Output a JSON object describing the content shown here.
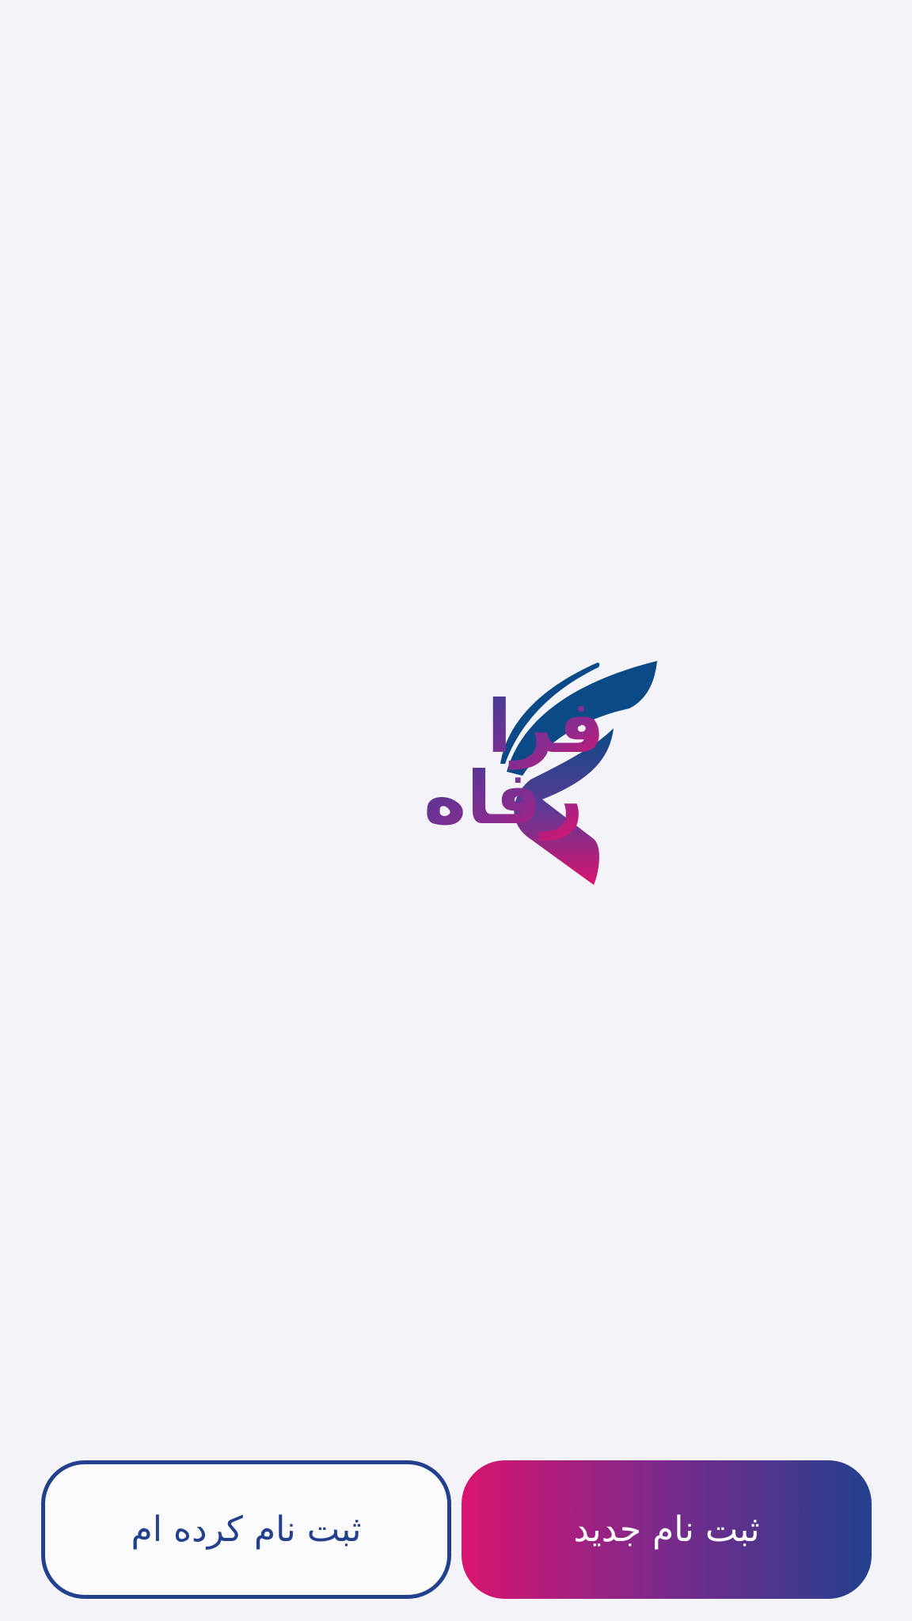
{
  "logo": {
    "brand_text_line1": "فرا",
    "brand_text_line2": "رفاه",
    "colors": {
      "navy": "#0b4a86",
      "purple": "#7a2f92",
      "magenta": "#d9146f"
    }
  },
  "actions": {
    "already_registered_label": "ثبت نام کرده ام",
    "new_signup_label": "ثبت نام جدید",
    "primary_gradient": [
      "#d9146f",
      "#7a2a8c",
      "#23408e"
    ],
    "secondary_border_color": "#23408e"
  }
}
